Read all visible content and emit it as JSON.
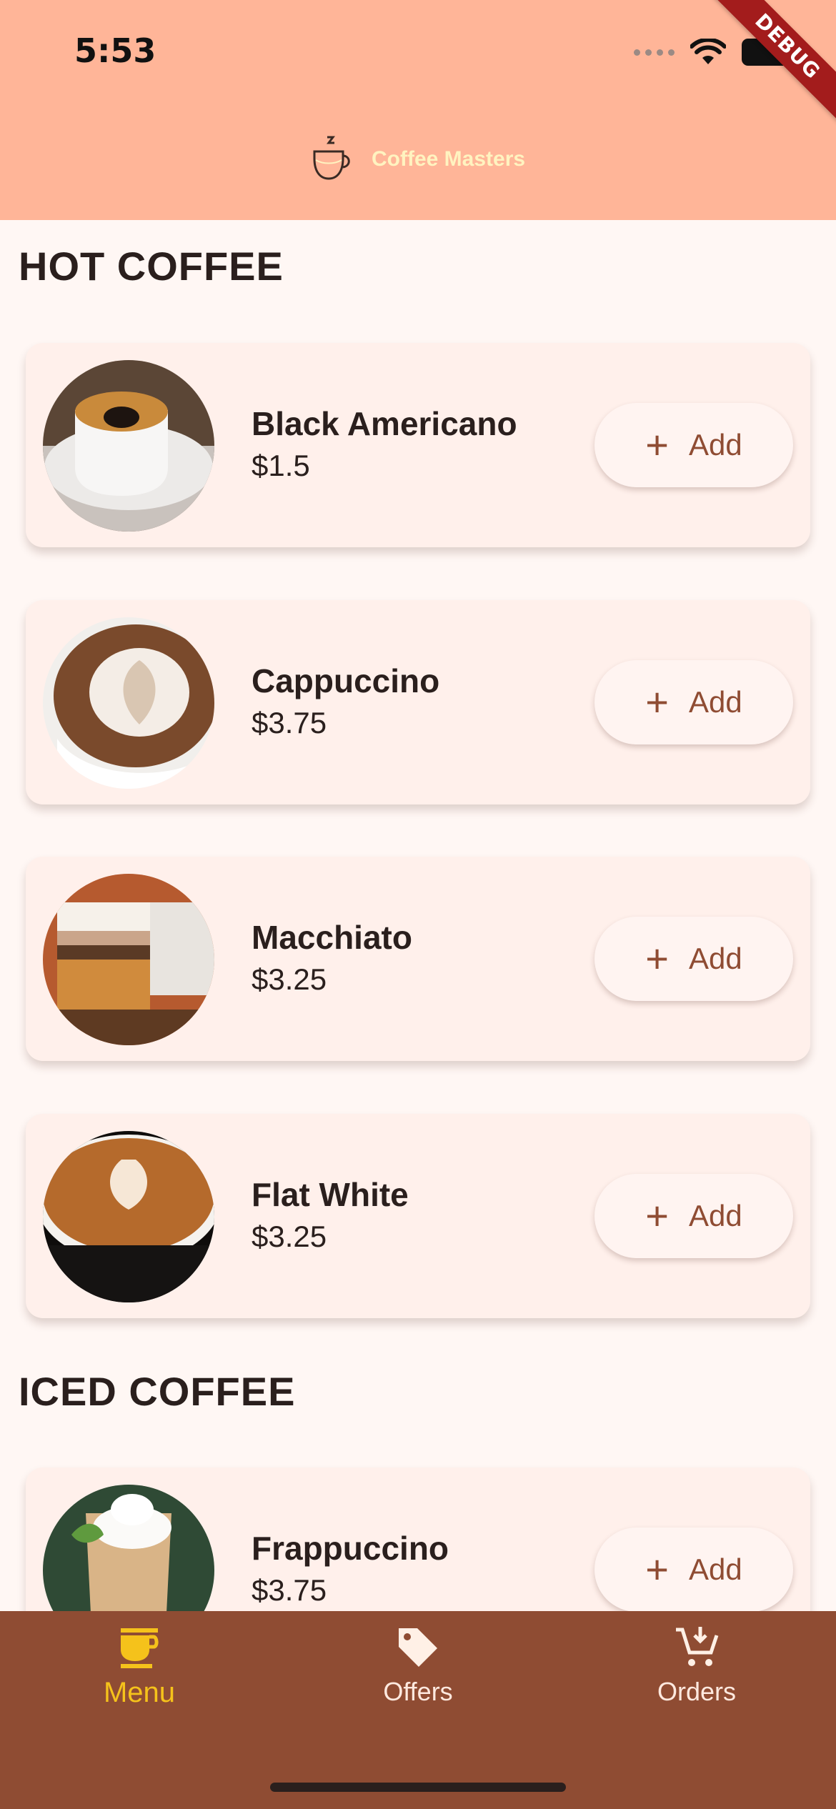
{
  "status_bar": {
    "time": "5:53",
    "debug_label": "DEBUG"
  },
  "header": {
    "brand_title": "Coffee Masters",
    "logo_icon": "coffee-cup-icon"
  },
  "sections": [
    {
      "title": "HOT COFFEE",
      "items": [
        {
          "name": "Black Americano",
          "price": "$1.5",
          "add_label": "Add"
        },
        {
          "name": "Cappuccino",
          "price": "$3.75",
          "add_label": "Add"
        },
        {
          "name": "Macchiato",
          "price": "$3.25",
          "add_label": "Add"
        },
        {
          "name": "Flat White",
          "price": "$3.25",
          "add_label": "Add"
        }
      ]
    },
    {
      "title": "ICED COFFEE",
      "items": [
        {
          "name": "Frappuccino",
          "price": "$3.75",
          "add_label": "Add"
        }
      ]
    }
  ],
  "bottom_nav": [
    {
      "label": "Menu",
      "icon": "coffee-cup-icon",
      "active": true
    },
    {
      "label": "Offers",
      "icon": "tag-icon",
      "active": false
    },
    {
      "label": "Orders",
      "icon": "cart-add-icon",
      "active": false
    }
  ],
  "colors": {
    "appbar": "#FFB598",
    "background": "#FFF7F4",
    "card": "#FFF0EB",
    "accent_brown": "#8F4C33",
    "active_nav": "#F5C21B",
    "debug_ribbon": "#A31C1C"
  }
}
